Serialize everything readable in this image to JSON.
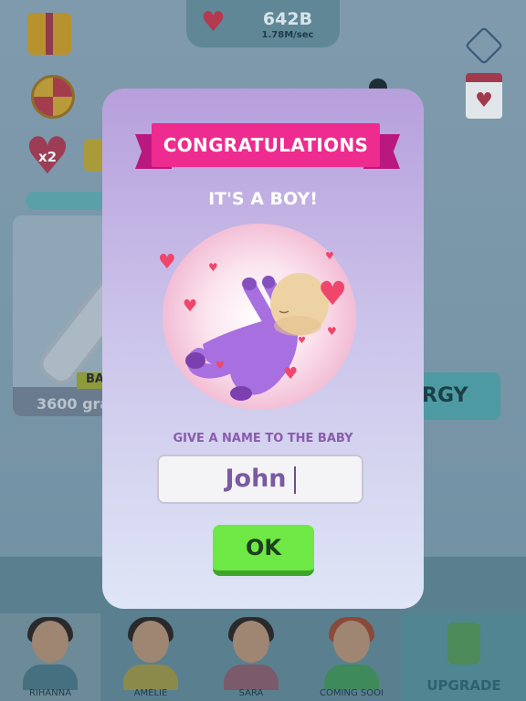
{
  "hud": {
    "hearts_total": "642B",
    "hearts_rate": "1.78M/sec",
    "multiplier": "x2"
  },
  "background": {
    "card_badge": "BA",
    "card_grams": "3600 gra",
    "energy_label": "RGY",
    "characters": [
      {
        "name": "RIHANNA",
        "selected": true
      },
      {
        "name": "AMELIE",
        "selected": false
      },
      {
        "name": "SARA",
        "selected": false
      },
      {
        "name": "COMING SOOI",
        "selected": false
      }
    ],
    "upgrade_label": "UPGRADE"
  },
  "modal": {
    "banner": "CONGRATULATIONS",
    "subtitle": "IT'S A BOY!",
    "prompt": "GIVE A NAME TO THE BABY",
    "name_value": "John",
    "ok_label": "OK"
  },
  "colors": {
    "banner": "#ee2b8f",
    "ok_button": "#6ee844",
    "baby_suit": "#a86fe0",
    "heart": "#f0466b"
  }
}
